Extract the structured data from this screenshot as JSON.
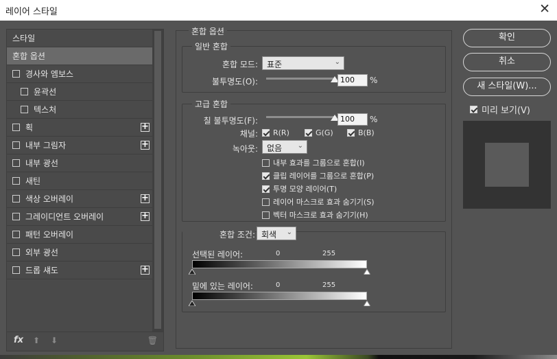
{
  "window": {
    "title": "레이어 스타일",
    "close_glyph": "✕"
  },
  "styles": {
    "header": "스타일",
    "items": [
      {
        "label": "혼합 옵션",
        "selected": true
      },
      {
        "label": "경사와 엠보스"
      },
      {
        "label": "윤곽선",
        "sub": true
      },
      {
        "label": "텍스처",
        "sub": true
      },
      {
        "label": "획",
        "plus": true
      },
      {
        "label": "내부 그림자",
        "plus": true
      },
      {
        "label": "내부 광선"
      },
      {
        "label": "새틴"
      },
      {
        "label": "색상 오버레이",
        "plus": true
      },
      {
        "label": "그레이디언트 오버레이",
        "plus": true
      },
      {
        "label": "패턴 오버레이"
      },
      {
        "label": "외부 광선"
      },
      {
        "label": "드롭 섀도",
        "plus": true
      }
    ],
    "footer": {
      "fx": "fx",
      "up": "⬆",
      "down": "⬇",
      "trash": "🗑"
    }
  },
  "blend": {
    "section_title": "혼합 옵션",
    "general": {
      "title": "일반 혼합",
      "mode_label": "혼합 모드:",
      "mode_value": "표준",
      "opacity_label": "불투명도(O):",
      "opacity_value": "100",
      "opacity_percent": 100,
      "unit": "%"
    },
    "advanced": {
      "title": "고급 혼합",
      "fill_label": "칠 불투명도(F):",
      "fill_value": "100",
      "fill_percent": 100,
      "unit": "%",
      "channels_label": "채널:",
      "channels": [
        "R(R)",
        "G(G)",
        "B(B)"
      ],
      "knockout_label": "녹아웃:",
      "knockout_value": "없음",
      "options": [
        {
          "label": "내부 효과를 그룹으로 혼합(I)",
          "checked": false
        },
        {
          "label": "클립 레이어를 그룹으로 혼합(P)",
          "checked": true
        },
        {
          "label": "투명 모양 레이어(T)",
          "checked": true
        },
        {
          "label": "레이어 마스크로 효과 숨기기(S)",
          "checked": false
        },
        {
          "label": "벡터 마스크로 효과 숨기기(H)",
          "checked": false
        }
      ]
    },
    "blend_if": {
      "label": "혼합 조건:",
      "value": "회색",
      "this_layer_label": "선택된 레이어:",
      "this_low": "0",
      "this_high": "255",
      "underlying_label": "밑에 있는 레이어:",
      "under_low": "0",
      "under_high": "255"
    }
  },
  "actions": {
    "ok": "확인",
    "cancel": "취소",
    "new_style": "새 스타일(W)...",
    "preview": "미리 보기(V)",
    "preview_checked": true
  }
}
